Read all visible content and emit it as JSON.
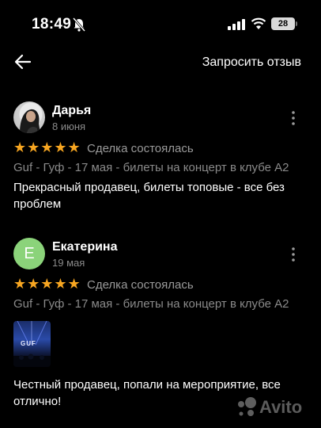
{
  "status_bar": {
    "time": "18:49",
    "battery": "28"
  },
  "nav": {
    "request_label": "Запросить отзыв"
  },
  "reviews": [
    {
      "author": "Дарья",
      "date": "8 июня",
      "stars": "★★★★★",
      "deal_status": "Сделка состоялась",
      "item": "Guf - Гуф - 17 мая - билеты на концерт в клубе А2",
      "text": "Прекрасный продавец, билеты топовые - все без проблем"
    },
    {
      "author": "Екатерина",
      "avatar_letter": "Е",
      "date": "19 мая",
      "stars": "★★★★★",
      "deal_status": "Сделка состоялась",
      "item": "Guf - Гуф - 17 мая - билеты на концерт в клубе А2",
      "photo_text": "GUF",
      "text": "Честный продавец, попали на мероприятие, все отлично!"
    }
  ],
  "watermark": {
    "text": "Avito"
  },
  "colors": {
    "star": "#f7a621",
    "avatar_green": "#8bd37a",
    "muted": "#8a8a8a",
    "background": "#000000"
  }
}
